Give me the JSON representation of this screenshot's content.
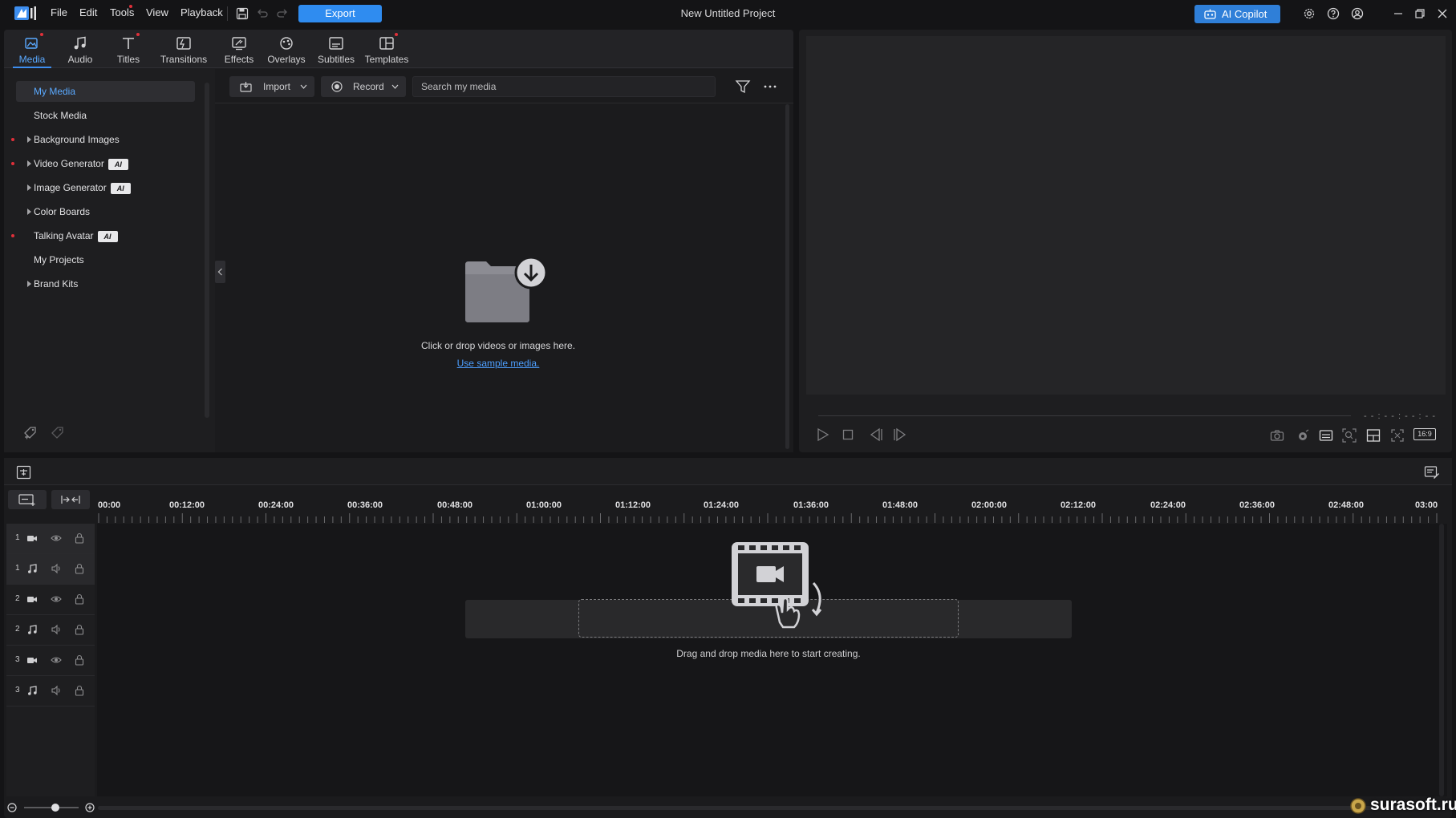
{
  "app": {
    "project_title": "New Untitled Project",
    "menu": [
      "File",
      "Edit",
      "Tools",
      "View",
      "Playback"
    ],
    "export_label": "Export",
    "copilot_label": "AI Copilot"
  },
  "tabs": [
    {
      "label": "Media",
      "icon": "media-icon"
    },
    {
      "label": "Audio",
      "icon": "music-note-icon"
    },
    {
      "label": "Titles",
      "icon": "text-icon"
    },
    {
      "label": "Transitions",
      "icon": "transition-icon"
    },
    {
      "label": "Effects",
      "icon": "effects-icon"
    },
    {
      "label": "Overlays",
      "icon": "overlays-icon"
    },
    {
      "label": "Subtitles",
      "icon": "subtitles-icon"
    },
    {
      "label": "Templates",
      "icon": "templates-icon"
    }
  ],
  "sidebar": {
    "items": [
      {
        "label": "My Media",
        "active": true
      },
      {
        "label": "Stock Media"
      },
      {
        "label": "Background Images"
      },
      {
        "label": "Video Generator",
        "badge": "AI"
      },
      {
        "label": "Image Generator",
        "badge": "AI"
      },
      {
        "label": "Color Boards"
      },
      {
        "label": "Talking Avatar",
        "badge": "AI"
      },
      {
        "label": "My Projects"
      },
      {
        "label": "Brand Kits"
      }
    ]
  },
  "media": {
    "import_label": "Import",
    "record_label": "Record",
    "search_placeholder": "Search my media",
    "empty_text": "Click or drop videos or images here.",
    "sample_link": "Use sample media."
  },
  "preview": {
    "timecode": "- - : - - : - - : - -",
    "aspect": "16:9"
  },
  "timeline": {
    "ruler": [
      "00:00",
      "00:12:00",
      "00:24:00",
      "00:36:00",
      "00:48:00",
      "01:00:00",
      "01:12:00",
      "01:24:00",
      "01:36:00",
      "01:48:00",
      "02:00:00",
      "02:12:00",
      "02:24:00",
      "02:36:00",
      "02:48:00",
      "03:00"
    ],
    "tracks": [
      {
        "num": "1",
        "type": "video"
      },
      {
        "num": "1",
        "type": "audio"
      },
      {
        "num": "2",
        "type": "video"
      },
      {
        "num": "2",
        "type": "audio"
      },
      {
        "num": "3",
        "type": "video"
      },
      {
        "num": "3",
        "type": "audio"
      }
    ],
    "drop_text": "Drag and drop media here to start creating."
  },
  "watermark": "surasoft.ru"
}
